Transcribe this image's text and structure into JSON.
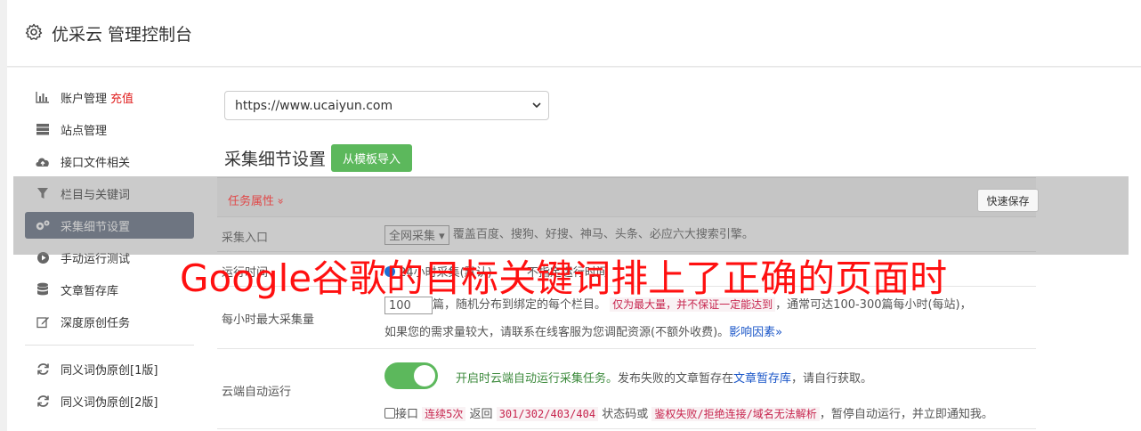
{
  "header": {
    "title": "优采云 管理控制台",
    "icon": "gear-icon"
  },
  "sidebar": {
    "items": [
      {
        "label": "账户管理",
        "badge": "充值",
        "icon": "bar-chart-icon"
      },
      {
        "label": "站点管理",
        "icon": "server-icon"
      },
      {
        "label": "接口文件相关",
        "icon": "cloud-upload-icon"
      },
      {
        "label": "栏目与关键词",
        "icon": "filter-icon"
      },
      {
        "label": "采集细节设置",
        "icon": "gears-icon",
        "active": true
      },
      {
        "label": "手动运行测试",
        "icon": "play-circle-icon"
      },
      {
        "label": "文章暂存库",
        "icon": "database-icon"
      },
      {
        "label": "深度原创任务",
        "icon": "edit-icon"
      },
      {
        "label": "同义词伪原创[1版]",
        "icon": "refresh-icon"
      },
      {
        "label": "同义词伪原创[2版]",
        "icon": "refresh-icon"
      }
    ]
  },
  "main": {
    "site_select": "https://www.ucaiyun.com",
    "section_title": "采集细节设置",
    "import_button": "从模板导入",
    "task_attr_label": "任务属性",
    "task_attr_chevron": "»",
    "quick_save": "快速保存",
    "rows": {
      "entry": {
        "label": "采集入口",
        "select": "全网采集",
        "desc": "覆盖百度、搜狗、好搜、神马、头条、必应六大搜索引擎。"
      },
      "runtime": {
        "label": "运行时间",
        "text": "24小时采集(默认)　　　不指定运行时间"
      },
      "max_per_hour": {
        "label": "每小时最大采集量",
        "value": "100",
        "text1": "篇，随机分布到绑定的每个栏目。",
        "code": "仅为最大量，并不保证一定能达到",
        "text2": "，通常可达100-300篇每小时(每站)，",
        "text3": "如果您的需求量较大，请联系在线客服为您调配资源(不额外收费)。",
        "link": "影响因素»"
      },
      "cloud_run": {
        "label": "云端自动运行",
        "green_text": "开启时云端自动运行采集任务。",
        "text1": "发布失败的文章暂存在",
        "link": "文章暂存库",
        "text2": "，请自行获取。",
        "api_label": "接口",
        "code1": "连续5次",
        "text3": "返回",
        "code2": "301/302/403/404",
        "text4": "状态码或",
        "code3": "鉴权失败/拒绝连接/域名无法解析",
        "text5": "，暂停自动运行，并立即通知我。"
      }
    }
  },
  "banner": "Google谷歌的目标关键词排上了正确的页面时",
  "colors": {
    "accent_green": "#5cb85c",
    "active_nav": "#5f6c80",
    "alert_red": "#e02020"
  }
}
